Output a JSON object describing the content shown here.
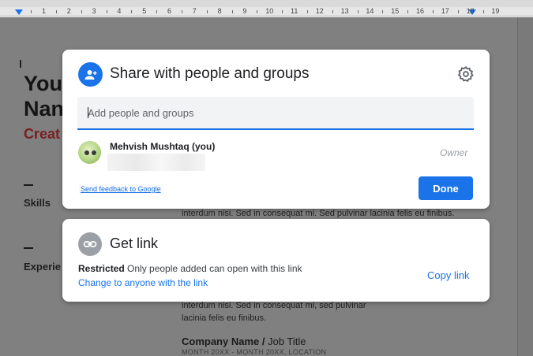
{
  "ruler": {
    "numbers": [
      "1",
      "2",
      "3",
      "4",
      "5",
      "6",
      "7",
      "8",
      "9",
      "10",
      "11",
      "12",
      "13",
      "14",
      "15",
      "16",
      "17",
      "18",
      "19"
    ]
  },
  "document": {
    "heading_line1": "You",
    "heading_line2": "Nan",
    "subtitle": "Creat",
    "section_skills": "Skills",
    "section_experience": "Experie",
    "paragraph1": "interdum nisi. Sed in consequat mi. Sed pulvinar lacinia felis eu finibus.",
    "paragraph2_line1": "interdum nisi. Sed in consequat mi, sed pulvinar",
    "paragraph2_line2": "lacinia felis eu finibus.",
    "company_name": "Company Name /",
    "job_title": " Job Title",
    "date_line": "MONTH 20XX - MONTH 20XX, LOCATION"
  },
  "share_dialog": {
    "title": "Share with people and groups",
    "input_placeholder": "Add people and groups",
    "person_name": "Mehvish Mushtaq (you)",
    "person_role": "Owner",
    "feedback_link": "Send feedback to Google",
    "done_label": "Done"
  },
  "get_link": {
    "title": "Get link",
    "restricted_label": "Restricted",
    "restricted_desc": " Only people added can open with this link",
    "change_link": "Change to anyone with the link",
    "copy_link": "Copy link"
  },
  "colors": {
    "accent": "#1a73e8",
    "overlay": "#808080"
  }
}
